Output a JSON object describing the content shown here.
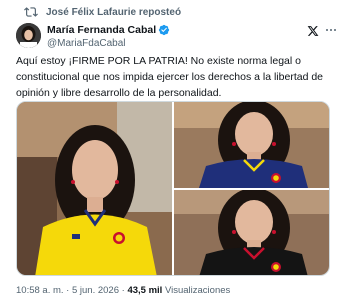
{
  "repost": {
    "text": "José Félix Lafaurie reposteó",
    "icon": "repost-icon"
  },
  "author": {
    "display_name": "María Fernanda Cabal",
    "handle": "@MariaFdaCabal",
    "verified": true,
    "verified_color": "#1d9bf0"
  },
  "tweet": {
    "text": "Aquí estoy ¡FIRME POR LA PATRIA! No existe norma legal o constitucional que nos impida ejercer los derechos a la libertad de opinión y libre desarrollo de la personalidad."
  },
  "media": {
    "photos": [
      {
        "jersey": "yellow",
        "jersey_color": "#f5d90a"
      },
      {
        "jersey": "navy",
        "jersey_color": "#1f2f7a"
      },
      {
        "jersey": "black",
        "jersey_color": "#141414"
      }
    ]
  },
  "meta": {
    "time": "10:58 a. m.",
    "separator": "·",
    "date": "5 jun. 2026",
    "views_count": "43,5 mil",
    "views_label": "Visualizaciones"
  },
  "colors": {
    "text": "#0f1419",
    "muted": "#536471",
    "accent": "#1d9bf0"
  }
}
